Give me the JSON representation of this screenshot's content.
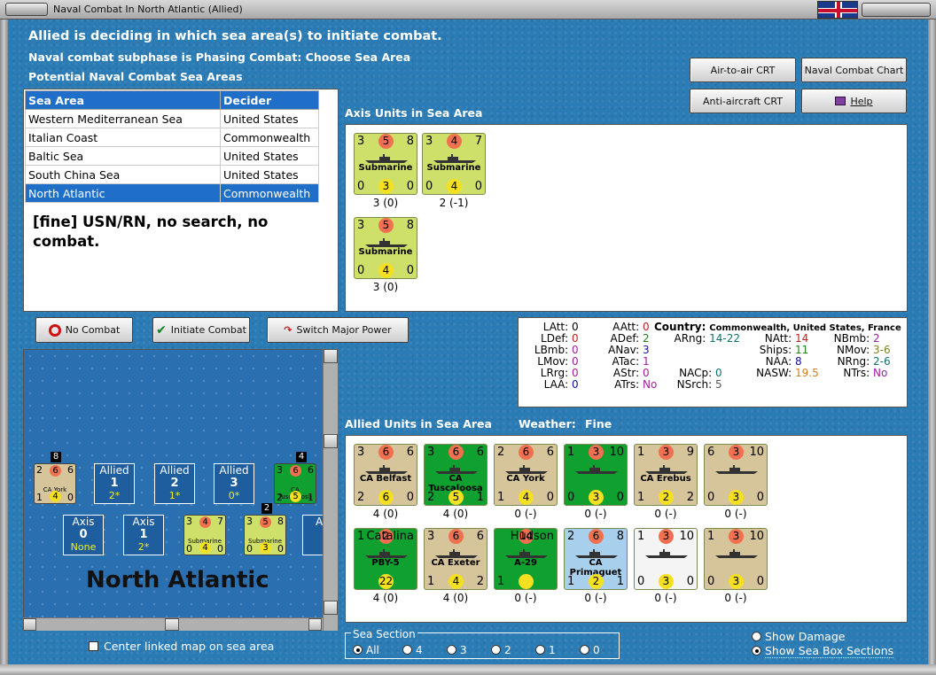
{
  "window": {
    "title": "Naval Combat In North Atlantic (Allied)"
  },
  "header": {
    "line1": "Allied is deciding in which sea area(s) to initiate combat.",
    "line2": "Naval combat subphase is Phasing Combat: Choose Sea Area",
    "line3": "Potential Naval Combat Sea Areas"
  },
  "buttons": {
    "air_to_air": "Air-to-air CRT",
    "naval_chart": "Naval Combat Chart",
    "anti_aircraft": "Anti-aircraft CRT",
    "help": "Help",
    "no_combat": "No Combat",
    "initiate": "Initiate Combat",
    "switch": "Switch Major Power"
  },
  "sea_table": {
    "headers": [
      "Sea Area",
      "Decider"
    ],
    "rows": [
      [
        "Western Mediterranean Sea",
        "United States"
      ],
      [
        "Italian Coast",
        "Commonwealth"
      ],
      [
        "Baltic Sea",
        "United States"
      ],
      [
        "South China Sea",
        "United States"
      ],
      [
        "North Atlantic",
        "Commonwealth"
      ]
    ],
    "selected": 4
  },
  "note": "[fine]  USN/RN, no search, no combat.",
  "axis_section": {
    "title": "Axis Units in Sea Area",
    "units": [
      {
        "tl": "3",
        "c": "5",
        "tr": "8",
        "name": "Submarine",
        "bl": "0",
        "cb": "3",
        "br": "0",
        "cap": "3 (0)"
      },
      {
        "tl": "3",
        "c": "4",
        "tr": "7",
        "name": "Submarine",
        "bl": "0",
        "cb": "4",
        "br": "0",
        "cap": "2 (-1)"
      },
      {
        "tl": "3",
        "c": "5",
        "tr": "8",
        "name": "Submarine",
        "bl": "0",
        "cb": "4",
        "br": "0",
        "cap": "3 (0)"
      }
    ]
  },
  "stats": {
    "country_label": "Country:",
    "country_value": "Commonwealth, United States, France",
    "latt": "LAtt:",
    "latt_v": "0",
    "ldef": "LDef:",
    "ldef_v": "0",
    "lbmb": "LBmb:",
    "lbmb_v": "0",
    "lmov": "LMov:",
    "lmov_v": "0",
    "lrrg": "LRrg:",
    "lrrg_v": "0",
    "laa": "LAA:",
    "laa_v": "0",
    "aatt": "AAtt:",
    "aatt_v": "0",
    "adef": "ADef:",
    "adef_v": "2",
    "anav": "ANav:",
    "anav_v": "3",
    "atac": "ATac:",
    "atac_v": "1",
    "astr": "AStr:",
    "astr_v": "0",
    "atrs": "ATrs:",
    "atrs_v": "No",
    "arng": "ARng:",
    "arng_v": "14-22",
    "nacp": "NACp:",
    "nacp_v": "0",
    "nsrch": "NSrch:",
    "nsrch_v": "5",
    "natt": "NAtt:",
    "natt_v": "14",
    "ships": "Ships:",
    "ships_v": "11",
    "naa": "NAA:",
    "naa_v": "8",
    "nasw": "NASW:",
    "nasw_v": "19.5",
    "nbmb": "NBmb:",
    "nbmb_v": "2",
    "nmov": "NMov:",
    "nmov_v": "3-6",
    "nrng": "NRng:",
    "nrng_v": "2-6",
    "ntrs": "NTrs:",
    "ntrs_v": "No"
  },
  "allied_section": {
    "title": "Allied Units in Sea Area",
    "weather_label": "Weather:",
    "weather_value": "Fine",
    "units": [
      {
        "tl": "3",
        "c": "6",
        "tr": "6",
        "name": "CA Belfast",
        "bl": "2",
        "cb": "6",
        "br": "0",
        "cap": "4 (0)",
        "bg": "brown"
      },
      {
        "tl": "3",
        "c": "6",
        "tr": "6",
        "name": "CA Tuscaloosa",
        "bl": "2",
        "cb": "5",
        "br": "1",
        "cap": "4 (0)",
        "bg": "green"
      },
      {
        "tl": "2",
        "c": "6",
        "tr": "6",
        "name": "CA York",
        "bl": "1",
        "cb": "4",
        "br": "0",
        "cap": "0 (-)",
        "bg": "brown"
      },
      {
        "tl": "1",
        "c": "3",
        "tr": "10",
        "name": "",
        "bl": "0",
        "cb": "3",
        "br": "0",
        "cap": "0 (-)",
        "bg": "green"
      },
      {
        "tl": "1",
        "c": "3",
        "tr": "9",
        "name": "CA Erebus",
        "bl": "1",
        "cb": "2",
        "br": "2",
        "cap": "0 (-)",
        "bg": "brown"
      },
      {
        "tl": "6",
        "c": "3",
        "tr": "10",
        "name": "",
        "bl": "0",
        "cb": "3",
        "br": "0",
        "cap": "0 (-)",
        "bg": "brown"
      },
      {
        "tl": "1",
        "c": "2",
        "tr": "Catalina",
        "name": "PBY-5",
        "bl": "",
        "cb": "22",
        "br": "",
        "cap": "4 (0)",
        "bg": "green"
      },
      {
        "tl": "3",
        "c": "6",
        "tr": "6",
        "name": "CA Exeter",
        "bl": "1",
        "cb": "4",
        "br": "2",
        "cap": "4 (0)",
        "bg": "brown"
      },
      {
        "tl": "",
        "c": "14",
        "tr": "Hudson",
        "name": "A-29",
        "bl": "1",
        "cb": "",
        "br": "",
        "cap": "0 (-)",
        "bg": "green"
      },
      {
        "tl": "2",
        "c": "6",
        "tr": "8",
        "name": "CA Primaguet",
        "bl": "1",
        "cb": "2",
        "br": "1",
        "cap": "0 (-)",
        "bg": "lblue"
      },
      {
        "tl": "1",
        "c": "3",
        "tr": "10",
        "name": "",
        "bl": "0",
        "cb": "3",
        "br": "0",
        "cap": "0 (-)",
        "bg": "white"
      },
      {
        "tl": "1",
        "c": "3",
        "tr": "10",
        "name": "",
        "bl": "0",
        "cb": "3",
        "br": "0",
        "cap": "0 (-)",
        "bg": "brown"
      }
    ]
  },
  "map": {
    "sea_name": "North Atlantic",
    "boxes": [
      {
        "side": "Allied",
        "num": "1",
        "val": "2*"
      },
      {
        "side": "Allied",
        "num": "2",
        "val": "1*"
      },
      {
        "side": "Allied",
        "num": "3",
        "val": "0*"
      },
      {
        "side": "Axis",
        "num": "0",
        "val": "None"
      },
      {
        "side": "Axis",
        "num": "1",
        "val": "2*"
      }
    ],
    "counts": [
      "8",
      "4",
      "2"
    ],
    "units": [
      {
        "tl": "2",
        "c": "6",
        "tr": "6",
        "name": "CA York",
        "bl": "1",
        "cb": "4",
        "br": "0"
      },
      {
        "tl": "3",
        "c": "6",
        "tr": "6",
        "name": "CA Tuscaloosa",
        "bl": "2",
        "cb": "5",
        "br": "1"
      },
      {
        "tl": "3",
        "c": "4",
        "tr": "7",
        "name": "Submarine",
        "bl": "0",
        "cb": "4",
        "br": "0"
      },
      {
        "tl": "3",
        "c": "5",
        "tr": "8",
        "name": "Submarine",
        "bl": "0",
        "cb": "3",
        "br": "0"
      }
    ]
  },
  "center_linked": "Center linked map on sea area",
  "sea_section": {
    "label": "Sea Section",
    "options": [
      "All",
      "4",
      "3",
      "2",
      "1",
      "0"
    ],
    "selected": 0
  },
  "show_damage": "Show Damage",
  "show_sections": "Show Sea Box Sections",
  "colors": {
    "ocean": "#2b7bb5",
    "table_header": "#1f6fc8",
    "sub_counter": "#cfe06a",
    "attack_circle": "#f07050",
    "defense_circle": "#f4e020"
  }
}
